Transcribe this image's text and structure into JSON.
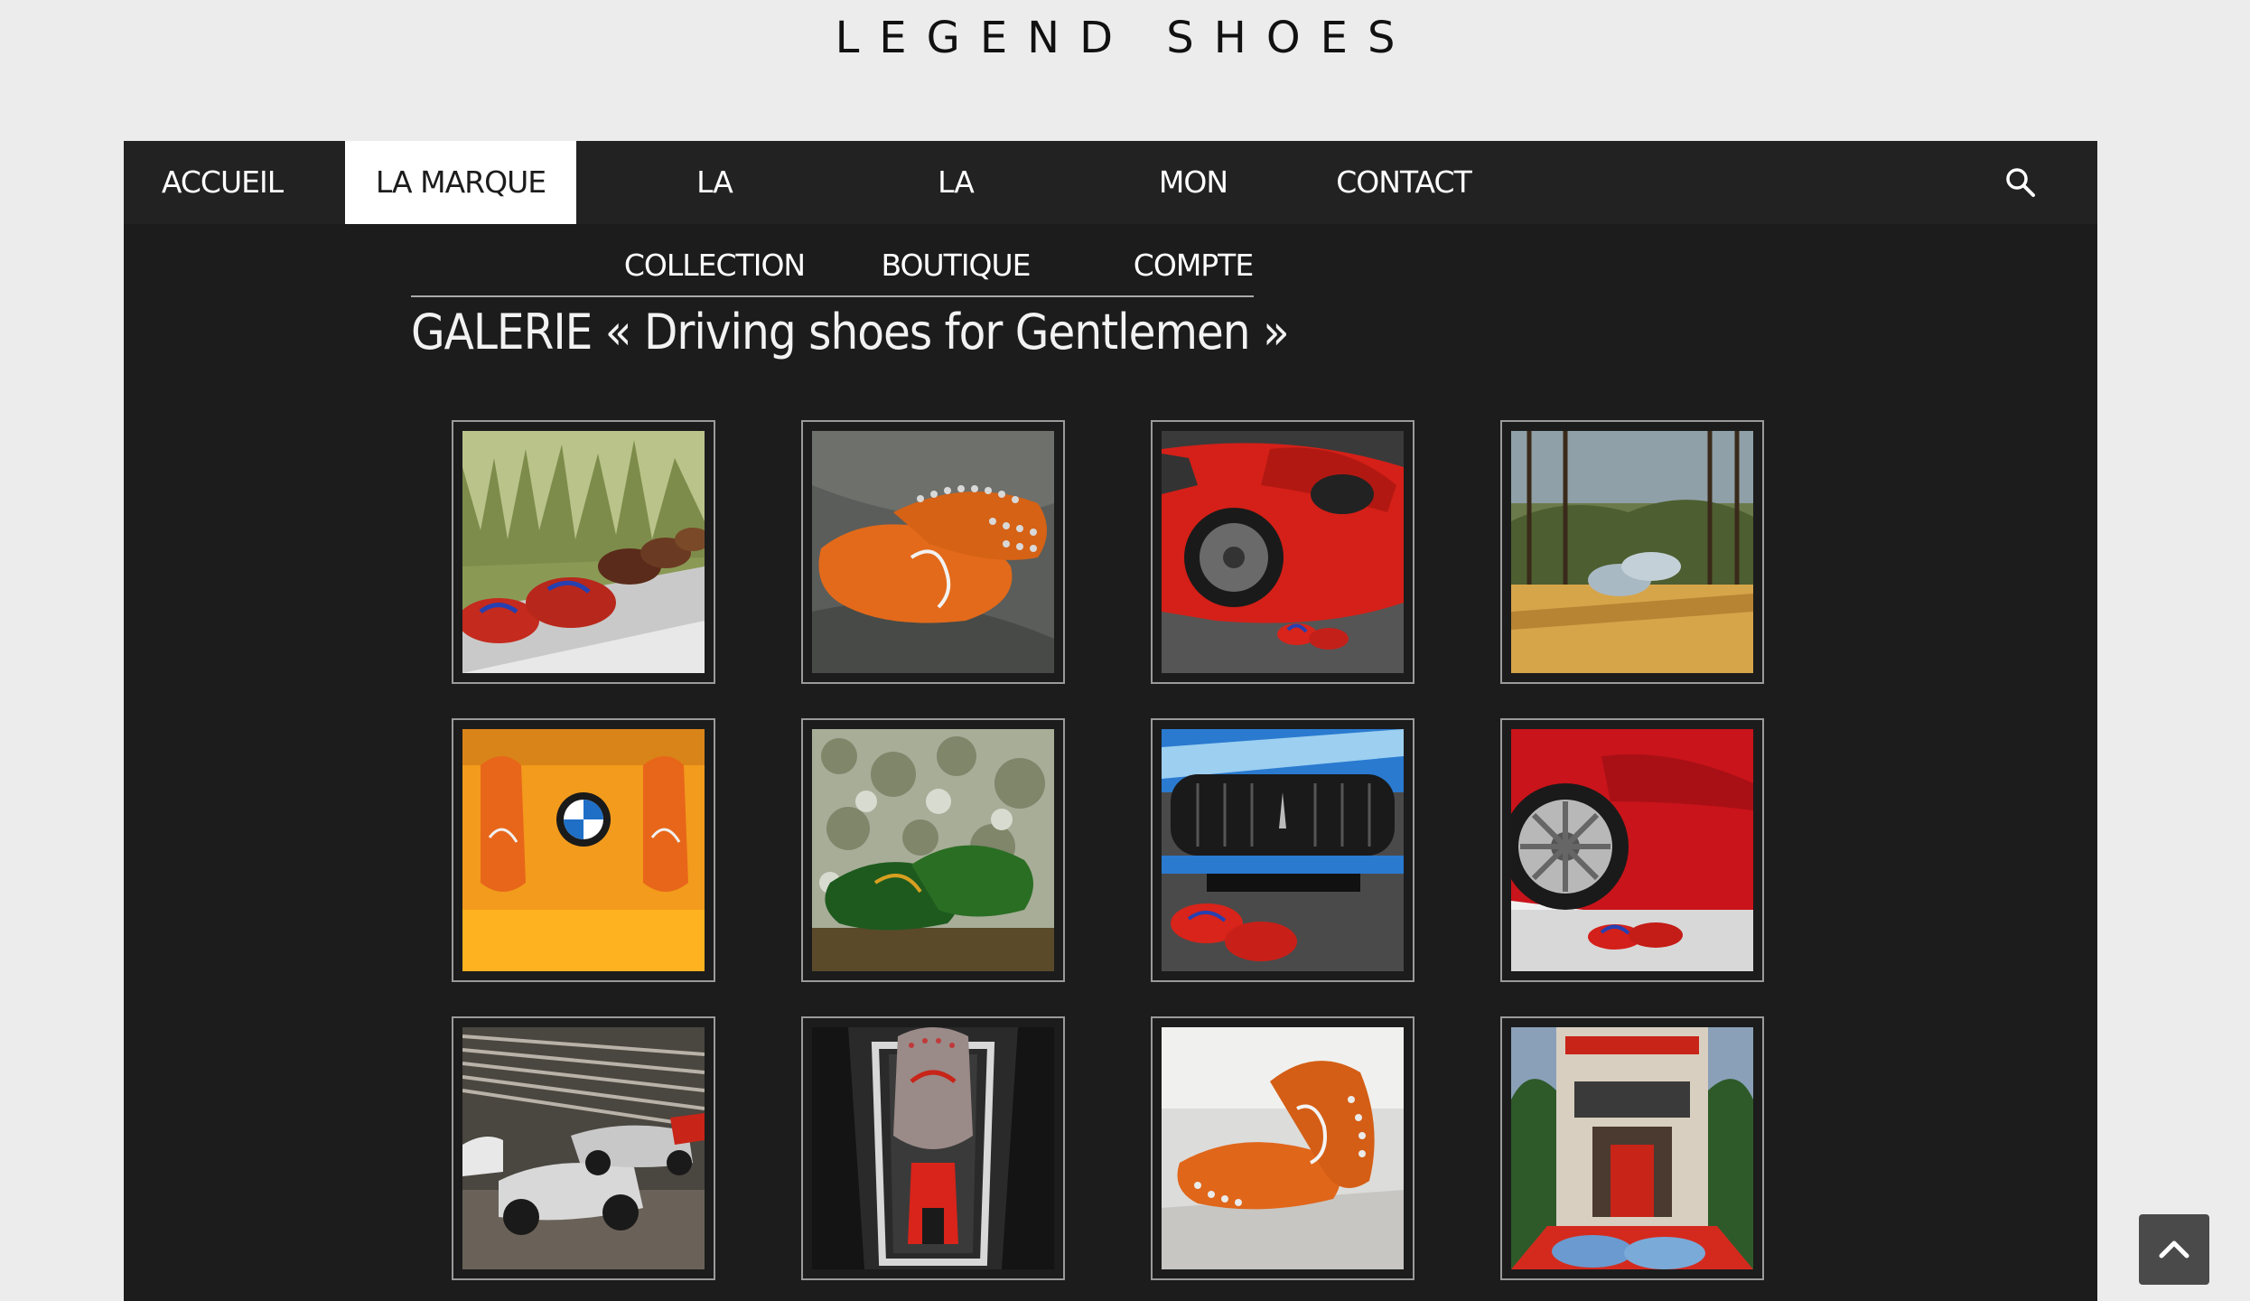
{
  "site": {
    "logo": "LEGEND SHOES"
  },
  "nav": {
    "items": [
      {
        "label": "ACCUEIL",
        "active": false
      },
      {
        "label": "LA MARQUE",
        "active": true
      },
      {
        "label": "LA COLLECTION",
        "active": false
      },
      {
        "label": "LA BOUTIQUE",
        "active": false
      },
      {
        "label": "MON COMPTE",
        "active": false
      },
      {
        "label": "CONTACT",
        "active": false
      }
    ],
    "search_icon": "search-icon"
  },
  "page": {
    "title": "GALERIE « Driving shoes for Gentlemen »"
  },
  "gallery": {
    "images": [
      "red-shoes-in-grass-photo",
      "orange-loafers-on-grey-fabric-photo",
      "red-sports-car-with-shoes-photo",
      "grey-loafers-on-terrace-photo",
      "orange-loafers-with-bmw-badge-photo",
      "green-loafers-photo",
      "blue-maserati-with-red-shoes-photo",
      "red-ferrari-with-shoes-photo",
      "vintage-race-cars-museum-photo",
      "grey-loafer-on-engine-photo",
      "orange-loafers-on-reflective-surface-photo",
      "casino-entrance-with-shoes-photo"
    ]
  },
  "scroll_to_top_icon": "chevron-up-icon"
}
